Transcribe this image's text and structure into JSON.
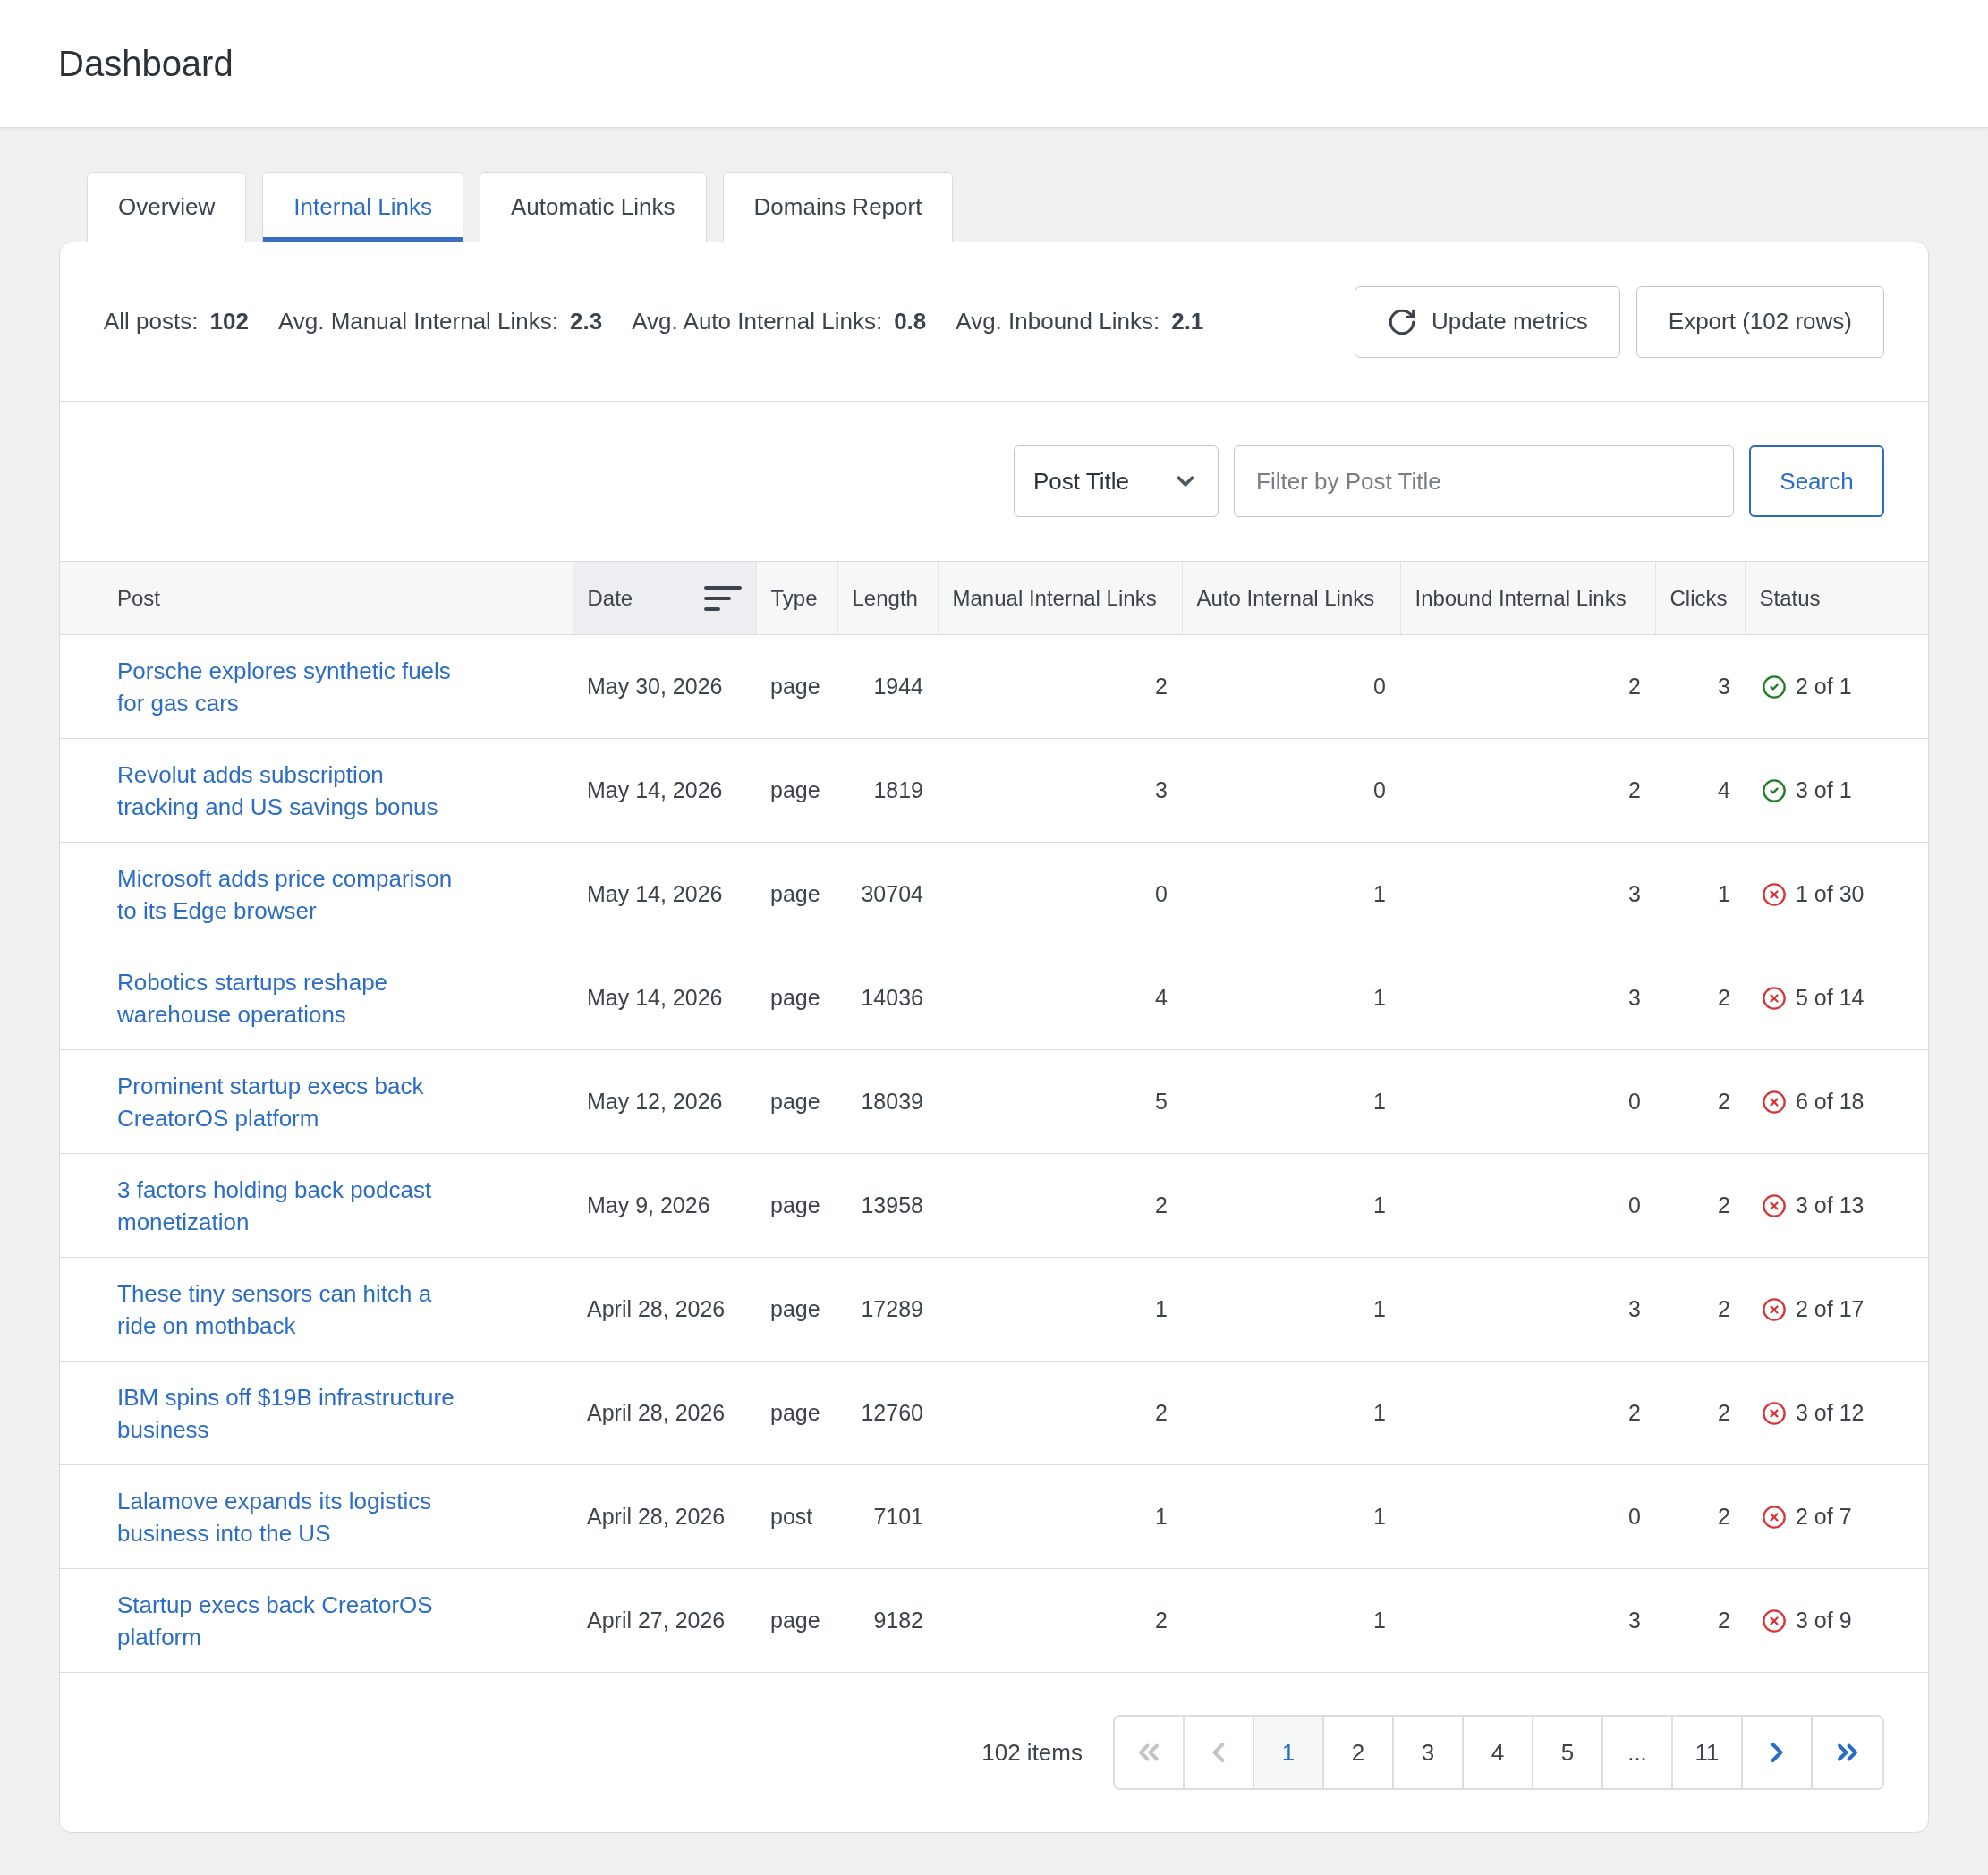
{
  "header": {
    "title": "Dashboard"
  },
  "tabs": [
    {
      "label": "Overview",
      "selected": false
    },
    {
      "label": "Internal Links",
      "selected": true
    },
    {
      "label": "Automatic Links",
      "selected": false
    },
    {
      "label": "Domains Report",
      "selected": false
    }
  ],
  "stats": [
    {
      "label": "All posts:",
      "value": "102"
    },
    {
      "label": "Avg. Manual Internal Links:",
      "value": "2.3"
    },
    {
      "label": "Avg. Auto Internal Links:",
      "value": "0.8"
    },
    {
      "label": "Avg. Inbound Links:",
      "value": "2.1"
    }
  ],
  "actions": [
    {
      "kind": "refresh",
      "label": "Update metrics"
    },
    {
      "kind": "plain",
      "label": "Export (102 rows)"
    }
  ],
  "filter": {
    "field": "Post Title",
    "placeholder": "Filter by Post Title",
    "button": "Search"
  },
  "table": {
    "columns": [
      {
        "label": "Post",
        "sorted": false
      },
      {
        "label": "Date",
        "sorted": true
      },
      {
        "label": "Type",
        "sorted": false
      },
      {
        "label": "Length",
        "sorted": false
      },
      {
        "label": "Manual Internal Links",
        "sorted": false
      },
      {
        "label": "Auto Internal Links",
        "sorted": false
      },
      {
        "label": "Inbound Internal Links",
        "sorted": false
      },
      {
        "label": "Clicks",
        "sorted": false
      },
      {
        "label": "Status",
        "sorted": false
      }
    ],
    "rows": [
      {
        "post": "Porsche explores synthetic fuels for gas cars",
        "date": "May 30, 2026",
        "type": "page",
        "length": "1944",
        "manual_internal_links": "2",
        "auto_internal_links": "0",
        "inbound_internal_links": "2",
        "clicks": "3",
        "status": {
          "passed": true,
          "text": "2 of 1"
        }
      },
      {
        "post": "Revolut adds subscription tracking and US savings bonus",
        "date": "May 14, 2026",
        "type": "page",
        "length": "1819",
        "manual_internal_links": "3",
        "auto_internal_links": "0",
        "inbound_internal_links": "2",
        "clicks": "4",
        "status": {
          "passed": true,
          "text": "3 of 1"
        }
      },
      {
        "post": "Microsoft adds price comparison to its Edge browser",
        "date": "May 14, 2026",
        "type": "page",
        "length": "30704",
        "manual_internal_links": "0",
        "auto_internal_links": "1",
        "inbound_internal_links": "3",
        "clicks": "1",
        "status": {
          "passed": false,
          "text": "1 of 30"
        }
      },
      {
        "post": "Robotics startups reshape warehouse operations",
        "date": "May 14, 2026",
        "type": "page",
        "length": "14036",
        "manual_internal_links": "4",
        "auto_internal_links": "1",
        "inbound_internal_links": "3",
        "clicks": "2",
        "status": {
          "passed": false,
          "text": "5 of 14"
        }
      },
      {
        "post": "Prominent startup execs back CreatorOS platform",
        "date": "May 12, 2026",
        "type": "page",
        "length": "18039",
        "manual_internal_links": "5",
        "auto_internal_links": "1",
        "inbound_internal_links": "0",
        "clicks": "2",
        "status": {
          "passed": false,
          "text": "6 of 18"
        }
      },
      {
        "post": "3 factors holding back podcast monetization",
        "date": "May 9, 2026",
        "type": "page",
        "length": "13958",
        "manual_internal_links": "2",
        "auto_internal_links": "1",
        "inbound_internal_links": "0",
        "clicks": "2",
        "status": {
          "passed": false,
          "text": "3 of 13"
        }
      },
      {
        "post": "These tiny sensors can hitch a ride on mothback",
        "date": "April 28, 2026",
        "type": "page",
        "length": "17289",
        "manual_internal_links": "1",
        "auto_internal_links": "1",
        "inbound_internal_links": "3",
        "clicks": "2",
        "status": {
          "passed": false,
          "text": "2 of 17"
        }
      },
      {
        "post": "IBM spins off $19B infrastructure business",
        "date": "April 28, 2026",
        "type": "page",
        "length": "12760",
        "manual_internal_links": "2",
        "auto_internal_links": "1",
        "inbound_internal_links": "2",
        "clicks": "2",
        "status": {
          "passed": false,
          "text": "3 of 12"
        }
      },
      {
        "post": "Lalamove expands its logistics business into the US",
        "date": "April 28, 2026",
        "type": "post",
        "length": "7101",
        "manual_internal_links": "1",
        "auto_internal_links": "1",
        "inbound_internal_links": "0",
        "clicks": "2",
        "status": {
          "passed": false,
          "text": "2 of 7"
        }
      },
      {
        "post": "Startup execs back CreatorOS platform",
        "date": "April 27, 2026",
        "type": "page",
        "length": "9182",
        "manual_internal_links": "2",
        "auto_internal_links": "1",
        "inbound_internal_links": "3",
        "clicks": "2",
        "status": {
          "passed": false,
          "text": "3 of 9"
        }
      }
    ]
  },
  "pagination": {
    "total": "102 items",
    "first": {
      "disabled": true
    },
    "prev": {
      "disabled": true
    },
    "pages": [
      {
        "label": "1",
        "selected": true
      },
      {
        "label": "2",
        "selected": false
      },
      {
        "label": "3",
        "selected": false
      },
      {
        "label": "4",
        "selected": false
      },
      {
        "label": "5",
        "selected": false
      },
      {
        "label": "...",
        "selected": false
      },
      {
        "label": "11",
        "selected": false
      }
    ],
    "next": {
      "disabled": false
    },
    "last": {
      "disabled": false
    }
  }
}
